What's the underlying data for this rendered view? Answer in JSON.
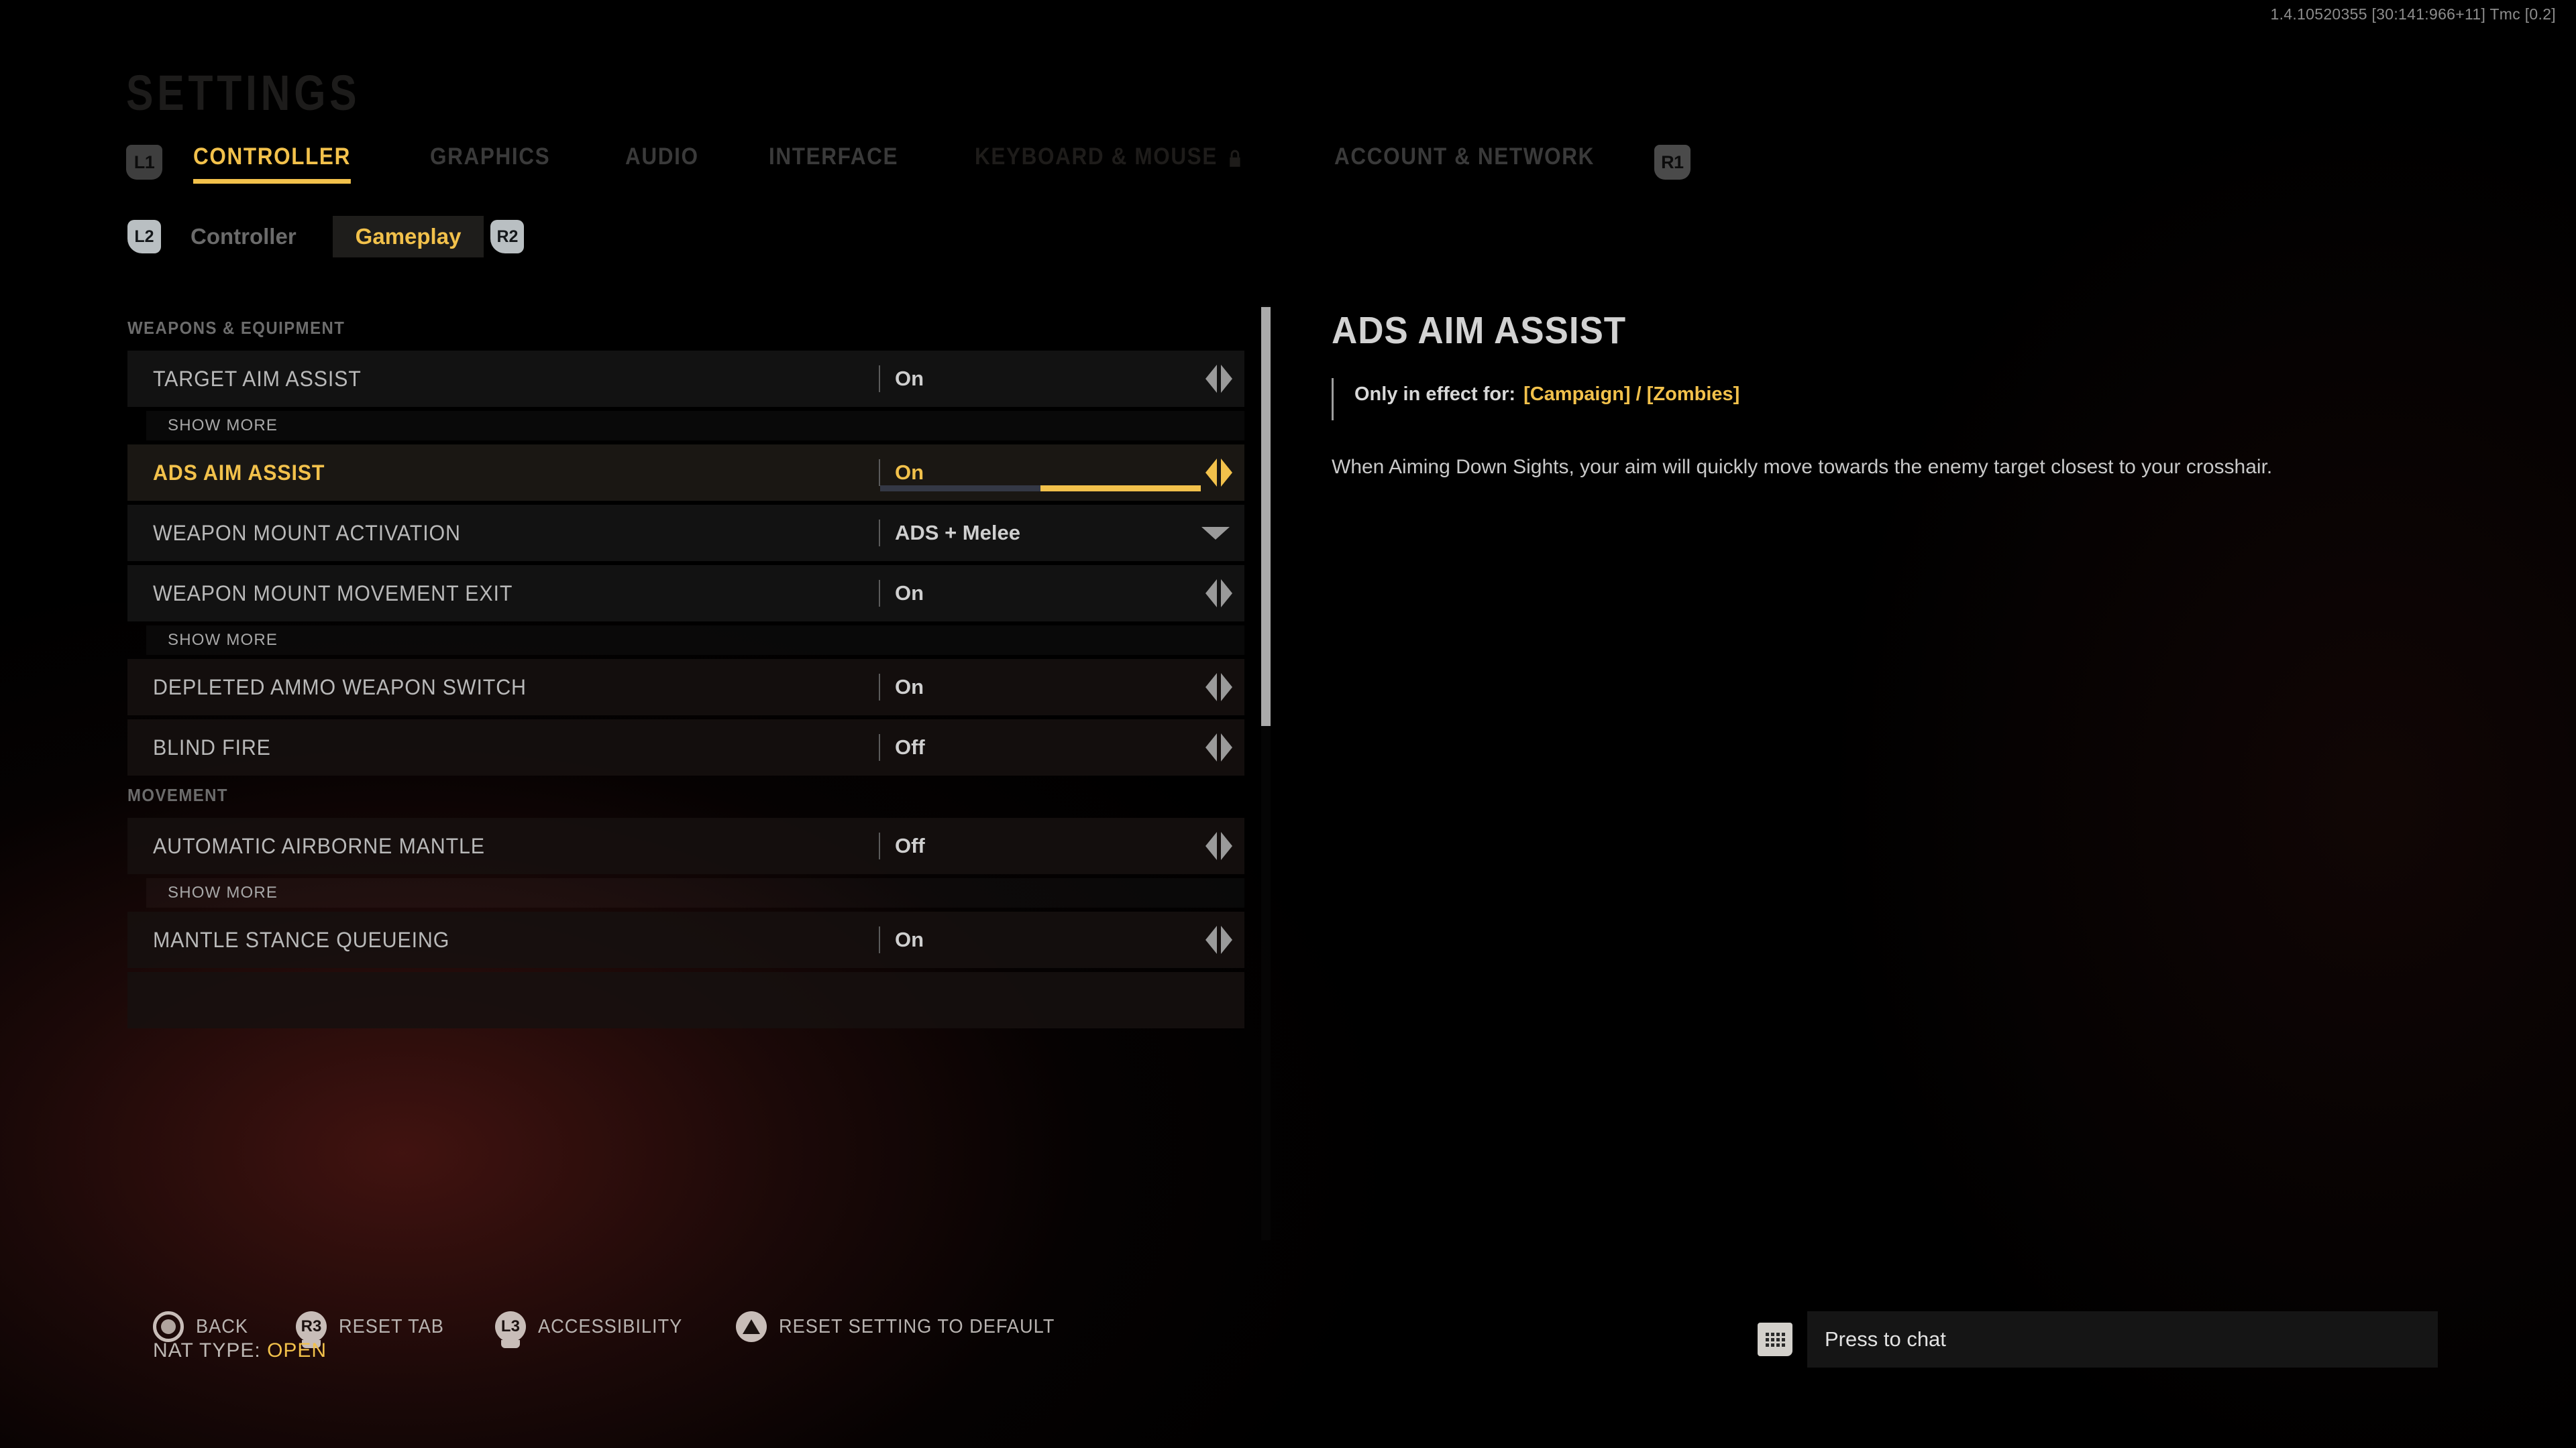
{
  "version": "1.4.10520355 [30:141:966+11] Tmc [0.2]",
  "page_title": "SETTINGS",
  "primary_tabs": {
    "left_bumper": "L1",
    "right_bumper": "R1",
    "items": [
      {
        "label": "CONTROLLER",
        "state": "active"
      },
      {
        "label": "GRAPHICS",
        "state": "normal"
      },
      {
        "label": "AUDIO",
        "state": "normal"
      },
      {
        "label": "INTERFACE",
        "state": "normal"
      },
      {
        "label": "KEYBOARD & MOUSE",
        "state": "locked",
        "icon": "lock-icon"
      },
      {
        "label": "ACCOUNT & NETWORK",
        "state": "normal"
      }
    ]
  },
  "sub_tabs": {
    "left_trigger": "L2",
    "right_trigger": "R2",
    "items": [
      {
        "label": "Controller",
        "state": "normal"
      },
      {
        "label": "Gameplay",
        "state": "active"
      }
    ]
  },
  "list": {
    "groups": [
      {
        "title": "WEAPONS & EQUIPMENT",
        "rows": [
          {
            "kind": "stepper",
            "label": "TARGET AIM ASSIST",
            "value": "On",
            "selected": false
          },
          {
            "kind": "showmore",
            "label": "SHOW MORE"
          },
          {
            "kind": "stepper",
            "label": "ADS AIM ASSIST",
            "value": "On",
            "selected": true,
            "toggle": {
              "off_pct": 50,
              "on_pct": 50
            }
          },
          {
            "kind": "dropdown",
            "label": "WEAPON MOUNT ACTIVATION",
            "value": "ADS + Melee",
            "selected": false
          },
          {
            "kind": "stepper",
            "label": "WEAPON MOUNT MOVEMENT EXIT",
            "value": "On",
            "selected": false
          },
          {
            "kind": "showmore",
            "label": "SHOW MORE"
          },
          {
            "kind": "stepper",
            "label": "DEPLETED AMMO WEAPON SWITCH",
            "value": "On",
            "selected": false
          },
          {
            "kind": "stepper",
            "label": "BLIND FIRE",
            "value": "Off",
            "selected": false
          }
        ]
      },
      {
        "title": "MOVEMENT",
        "rows": [
          {
            "kind": "stepper",
            "label": "AUTOMATIC AIRBORNE MANTLE",
            "value": "Off",
            "selected": false
          },
          {
            "kind": "showmore",
            "label": "SHOW MORE"
          },
          {
            "kind": "stepper",
            "label": "MANTLE STANCE QUEUEING",
            "value": "On",
            "selected": false
          }
        ]
      }
    ]
  },
  "detail": {
    "title": "ADS AIM ASSIST",
    "note_prefix": "Only in effect for:",
    "note_tags": "[Campaign] / [Zombies]",
    "description": "When Aiming Down Sights, your aim will quickly move towards the enemy target closest to your crosshair."
  },
  "bottom_bar": {
    "actions": [
      {
        "button": "circle-button-icon",
        "glyph": "",
        "label": "BACK"
      },
      {
        "button": "r3-stick-icon",
        "glyph": "R3",
        "label": "RESET TAB"
      },
      {
        "button": "l3-stick-icon",
        "glyph": "L3",
        "label": "ACCESSIBILITY"
      },
      {
        "button": "triangle-button-icon",
        "glyph": "",
        "label": "RESET SETTING TO DEFAULT"
      }
    ],
    "nat_type_label": "NAT TYPE:",
    "nat_type_value": "OPEN"
  },
  "chat": {
    "icon": "keyboard-icon",
    "label": "Press to chat"
  },
  "colors": {
    "accent": "#F2C14B",
    "row_bg": "#121212",
    "selected_row_bg": "#1A1713",
    "toggle_off": "#343845",
    "text": "#C9C9C9"
  }
}
